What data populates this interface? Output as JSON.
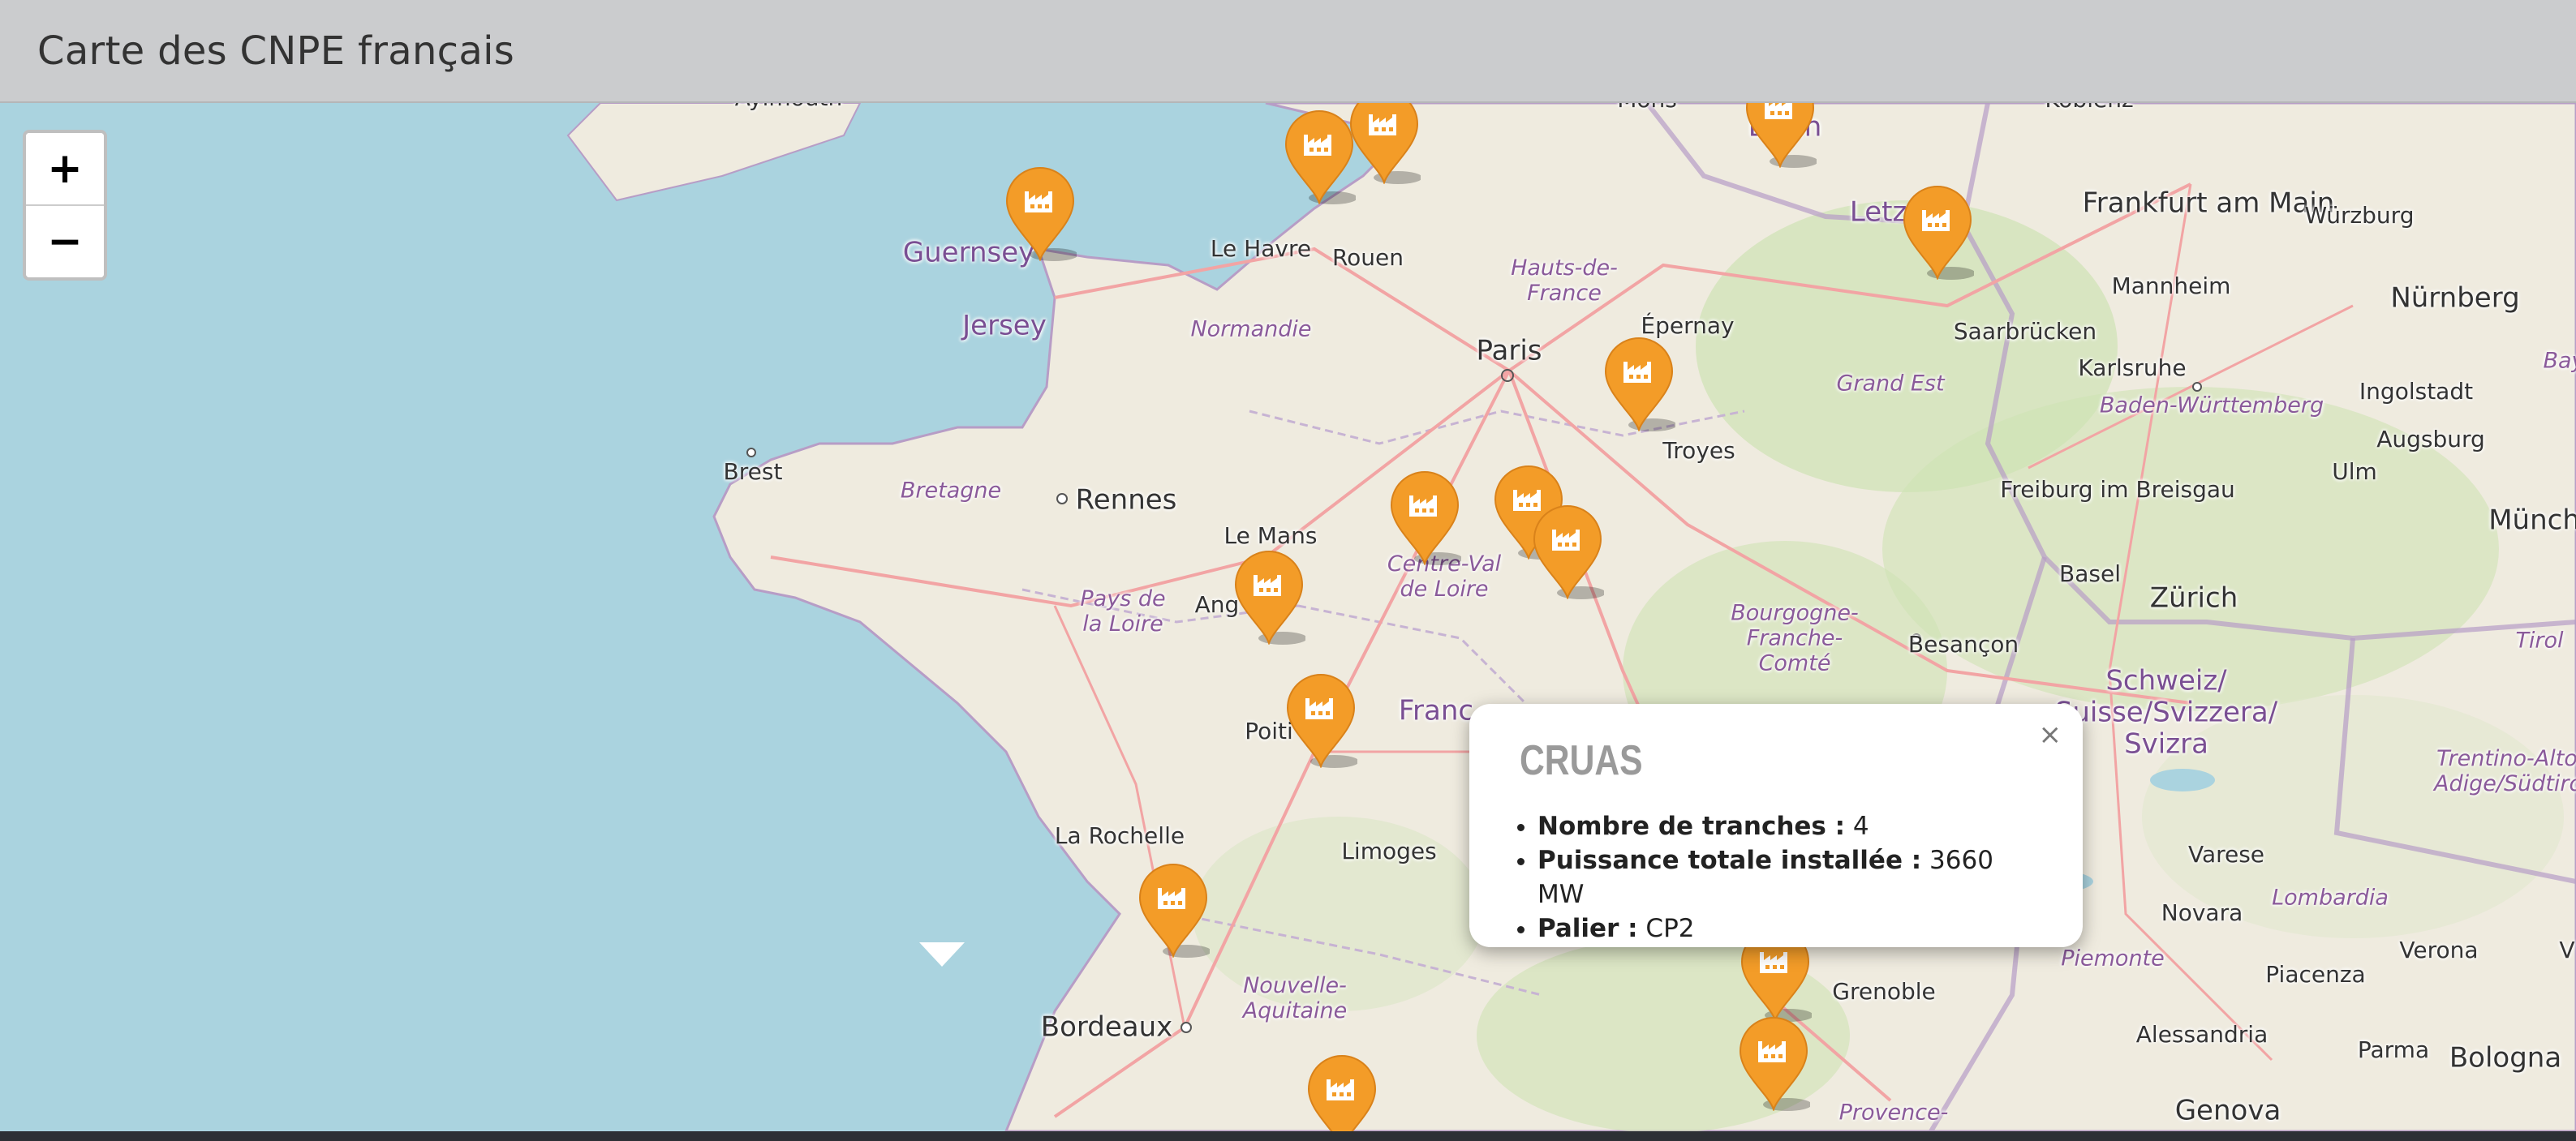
{
  "header": {
    "title": "Carte des CNPE français"
  },
  "zoom": {
    "in_label": "+",
    "out_label": "−"
  },
  "labels": {
    "cities": {
      "aylmouth": "Aylmouth",
      "mons": "Mons",
      "koblenz": "Koblenz",
      "frankfurt": "Frankfurt am Main",
      "wurzburg": "Würzburg",
      "le_havre": "Le Havre",
      "rouen": "Rouen",
      "mannheim": "Mannheim",
      "nurnberg": "Nürnberg",
      "epernay": "Épernay",
      "saarbrucken": "Saarbrücken",
      "paris": "Paris",
      "karlsruhe": "Karlsruhe",
      "ingolstadt": "Ingolstadt",
      "augsburg": "Augsburg",
      "brest": "Brest",
      "troyes": "Troyes",
      "rennes": "Rennes",
      "freiburg": "Freiburg im Breisgau",
      "ulm": "Ulm",
      "munchen": "Münche",
      "le_mans": "Le Mans",
      "basel": "Basel",
      "zurich": "Zürich",
      "angers": "Ang",
      "besancon": "Besançon",
      "poitiers": "Poiti",
      "la_rochelle": "La Rochelle",
      "limoges": "Limoges",
      "varese": "Varese",
      "novara": "Novara",
      "verona": "Verona",
      "bordeaux": "Bordeaux",
      "grenoble": "Grenoble",
      "piacenza": "Piacenza",
      "alessandria": "Alessandria",
      "parma": "Parma",
      "bologna": "Bologna",
      "genova": "Genova",
      "bay": "Bay",
      "v": "V"
    },
    "regions": {
      "hauts_de_france": "Hauts-de-France",
      "normandie": "Normandie",
      "grand_est": "Grand Est",
      "baden": "Baden-Württemberg",
      "bretagne": "Bretagne",
      "cvl": "Centre-Val de Loire",
      "pays_loire": "Pays de la Loire",
      "bfc": "Bourgogne-Franche-Comté",
      "tirol": "Tirol",
      "trentino": "Trentino-Alto Adige/Südtirol",
      "lombardia": "Lombardia",
      "piemonte": "Piemonte",
      "nouvelle_aquitaine": "Nouvelle-Aquitaine",
      "provence": "Provence-"
    },
    "countries": {
      "guernsey": "Guernsey",
      "jersey": "Jersey",
      "bruxelles": "Br      en",
      "letzebuerg": "Letz       rg",
      "france": "Franc",
      "schweiz": "Schweiz/ Suisse/Svizzera/ Svizra"
    }
  },
  "popup": {
    "title": "CRUAS",
    "close": "×",
    "items": [
      {
        "key": "Nombre de tranches :",
        "value": "4"
      },
      {
        "key": "Puissance totale installée :",
        "value": "3660 MW"
      },
      {
        "key": "Palier :",
        "value": "CP2"
      }
    ]
  },
  "markers": {
    "icon": "factory-icon",
    "color": "#f39c28",
    "count": 17
  },
  "colors": {
    "sea": "#aad3df",
    "land": "#efebdf",
    "forest": "#cfe3b4",
    "border": "#b79dc6",
    "road": "#f2a4a4",
    "header": "#cbccce",
    "marker": "#f39c28"
  }
}
